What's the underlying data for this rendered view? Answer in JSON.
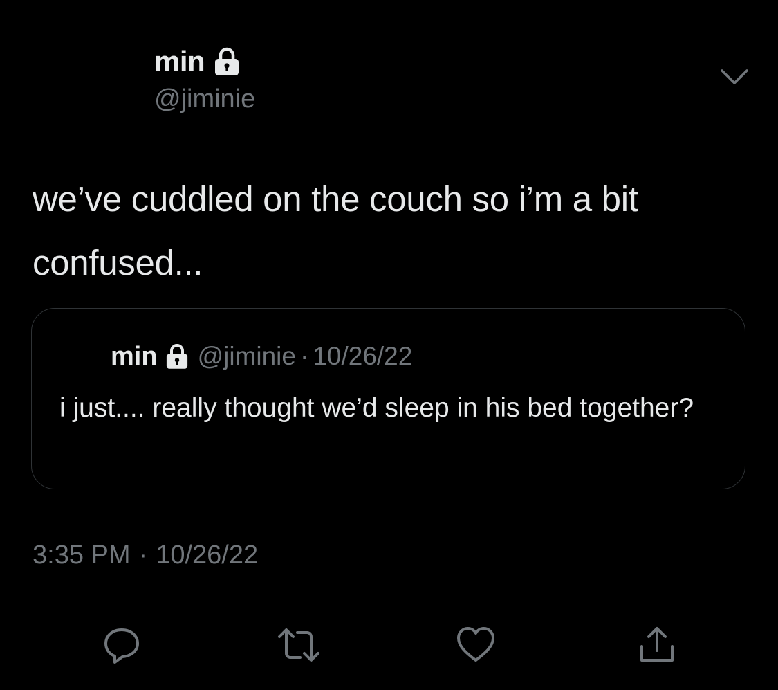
{
  "author": {
    "display_name": "min",
    "handle": "@jiminie",
    "protected": true
  },
  "tweet": {
    "text": "we’ve cuddled on the couch so i’m a bit confused...",
    "time": "3:35 PM",
    "separator": "·",
    "date": "10/26/22"
  },
  "quoted_tweet": {
    "display_name": "min",
    "handle": "@jiminie",
    "separator": "·",
    "date": "10/26/22",
    "text": "i just.... really thought we’d sleep in his bed together?"
  },
  "icons": {
    "lock": "lock-icon",
    "more": "chevron-down-icon",
    "reply": "reply-icon",
    "retweet": "retweet-icon",
    "like": "heart-icon",
    "share": "share-icon"
  },
  "colors": {
    "background": "#000000",
    "primary_text": "#e7e9ea",
    "secondary_text": "#71767b",
    "border": "#2f3336"
  }
}
